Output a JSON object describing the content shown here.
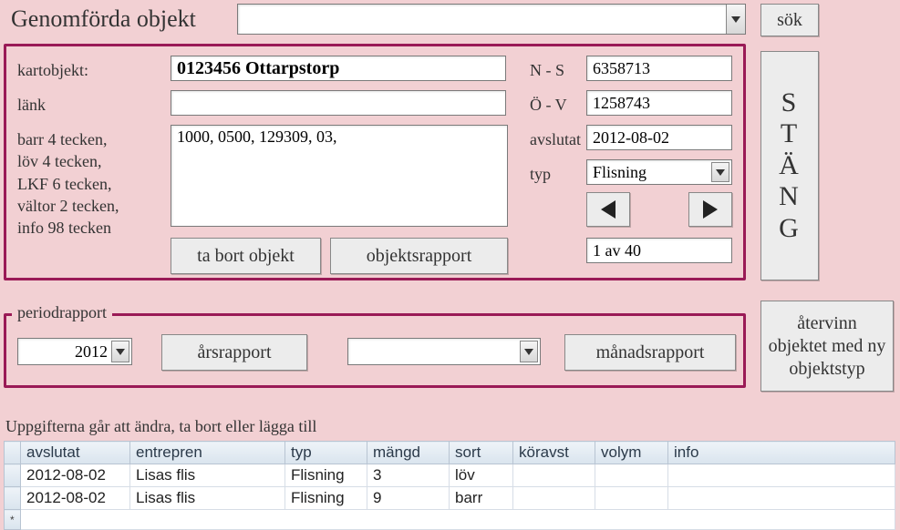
{
  "title": "Genomförda objekt",
  "buttons": {
    "sok": "sök",
    "stang": "STÄNG",
    "atervinn": "återvinn objektet med ny objektstyp",
    "ta_bort": "ta bort objekt",
    "objektsrapport": "objektsrapport",
    "arsrapport": "årsrapport",
    "manadsrapport": "månadsrapport"
  },
  "labels": {
    "kartobjekt": "kartobjekt:",
    "lank": "länk",
    "desc": "barr 4 tecken,\nlöv 4 tecken,\nLKF 6 tecken,\nvältor 2 tecken,\ninfo 98 tecken",
    "ns": "N - S",
    "ov": "Ö - V",
    "avslutat": "avslutat",
    "typ": "typ",
    "periodrapport": "periodrapport",
    "instr": "Uppgifterna går att ändra, ta bort eller lägga till"
  },
  "fields": {
    "top_select": "",
    "kartobjekt": "0123456 Ottarpstorp",
    "lank": "",
    "desc": "1000, 0500, 129309, 03,",
    "ns": "6358713",
    "ov": "1258743",
    "avslutat": "2012-08-02",
    "typ": "Flisning",
    "pager": "1 av 40",
    "year": "2012",
    "month": ""
  },
  "table": {
    "headers": [
      "avslutat",
      "entrepren",
      "typ",
      "mängd",
      "sort",
      "köravst",
      "volym",
      "info"
    ],
    "rows": [
      {
        "avslutat": "2012-08-02",
        "entrepren": "Lisas flis",
        "typ": "Flisning",
        "mangd": "3",
        "sort": "löv",
        "koravst": "",
        "volym": "",
        "info": ""
      },
      {
        "avslutat": "2012-08-02",
        "entrepren": "Lisas flis",
        "typ": "Flisning",
        "mangd": "9",
        "sort": "barr",
        "koravst": "",
        "volym": "",
        "info": ""
      }
    ]
  }
}
